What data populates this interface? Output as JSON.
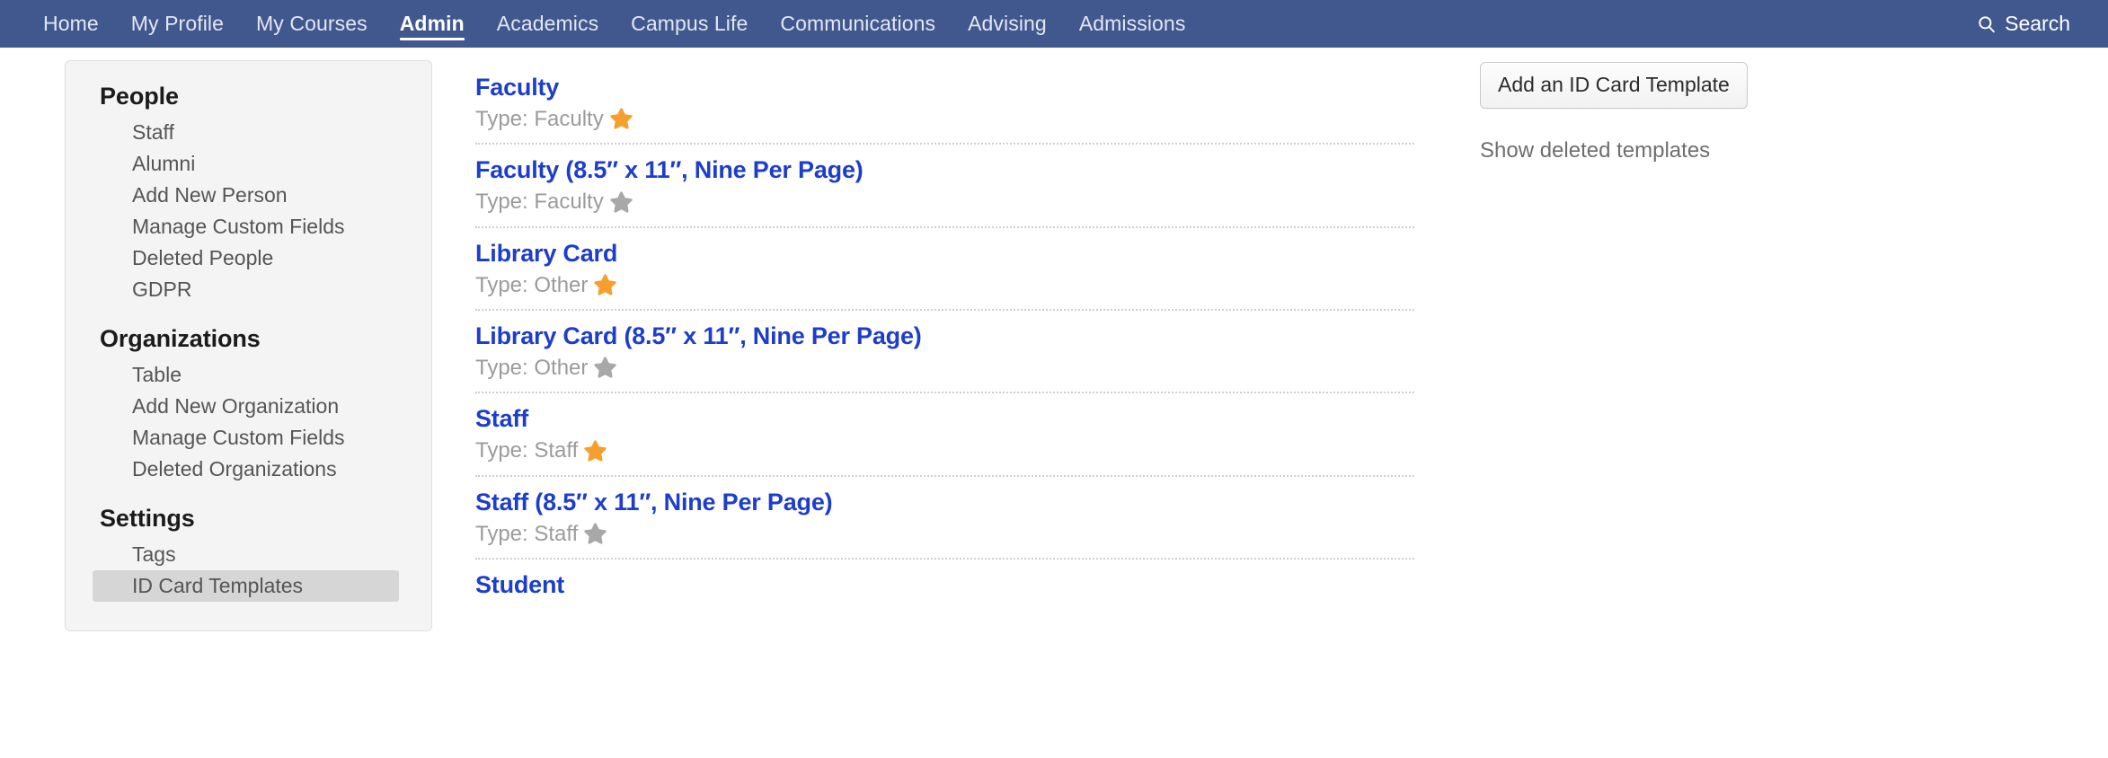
{
  "navbar": {
    "background_color": "#41588f",
    "items": [
      {
        "label": "Home",
        "active": false
      },
      {
        "label": "My Profile",
        "active": false
      },
      {
        "label": "My Courses",
        "active": false
      },
      {
        "label": "Admin",
        "active": true
      },
      {
        "label": "Academics",
        "active": false
      },
      {
        "label": "Campus Life",
        "active": false
      },
      {
        "label": "Communications",
        "active": false
      },
      {
        "label": "Advising",
        "active": false
      },
      {
        "label": "Admissions",
        "active": false
      }
    ],
    "search": {
      "label": "Search",
      "icon": "search-icon"
    }
  },
  "sidebar": {
    "groups": [
      {
        "heading": "People",
        "items": [
          {
            "label": "Staff",
            "selected": false
          },
          {
            "label": "Alumni",
            "selected": false
          },
          {
            "label": "Add New Person",
            "selected": false
          },
          {
            "label": "Manage Custom Fields",
            "selected": false
          },
          {
            "label": "Deleted People",
            "selected": false
          },
          {
            "label": "GDPR",
            "selected": false
          }
        ]
      },
      {
        "heading": "Organizations",
        "items": [
          {
            "label": "Table",
            "selected": false
          },
          {
            "label": "Add New Organization",
            "selected": false
          },
          {
            "label": "Manage Custom Fields",
            "selected": false
          },
          {
            "label": "Deleted Organizations",
            "selected": false
          }
        ]
      },
      {
        "heading": "Settings",
        "items": [
          {
            "label": "Tags",
            "selected": false
          },
          {
            "label": "ID Card Templates",
            "selected": true
          }
        ]
      }
    ]
  },
  "main": {
    "templates": [
      {
        "title": "Faculty",
        "meta": "Type: Faculty",
        "star": "star-icon",
        "star_color": "#f5a02e"
      },
      {
        "title": "Faculty (8.5″ x 11″, Nine Per Page)",
        "meta": "Type: Faculty",
        "star": "star-icon",
        "star_color": "#a8a8a8"
      },
      {
        "title": "Library Card",
        "meta": "Type: Other",
        "star": "star-icon",
        "star_color": "#f5a02e"
      },
      {
        "title": "Library Card (8.5″ x 11″, Nine Per Page)",
        "meta": "Type: Other",
        "star": "star-icon",
        "star_color": "#a8a8a8"
      },
      {
        "title": "Staff",
        "meta": "Type: Staff",
        "star": "star-icon",
        "star_color": "#f5a02e"
      },
      {
        "title": "Staff (8.5″ x 11″, Nine Per Page)",
        "meta": "Type: Staff",
        "star": "star-icon",
        "star_color": "#a8a8a8"
      },
      {
        "title": "Student",
        "meta": "",
        "star": "",
        "star_color": ""
      }
    ]
  },
  "right_rail": {
    "add_button_label": "Add an ID Card Template",
    "show_deleted_label": "Show deleted templates"
  },
  "colors": {
    "nav_background": "#41588f",
    "link_blue": "#1d3ecb",
    "meta_gray": "#9b9b9b",
    "star_active": "#f5a02e",
    "star_inactive": "#a8a8a8",
    "sidebar_background": "#f4f4f4",
    "sidebar_selected": "#d6d6d6"
  }
}
